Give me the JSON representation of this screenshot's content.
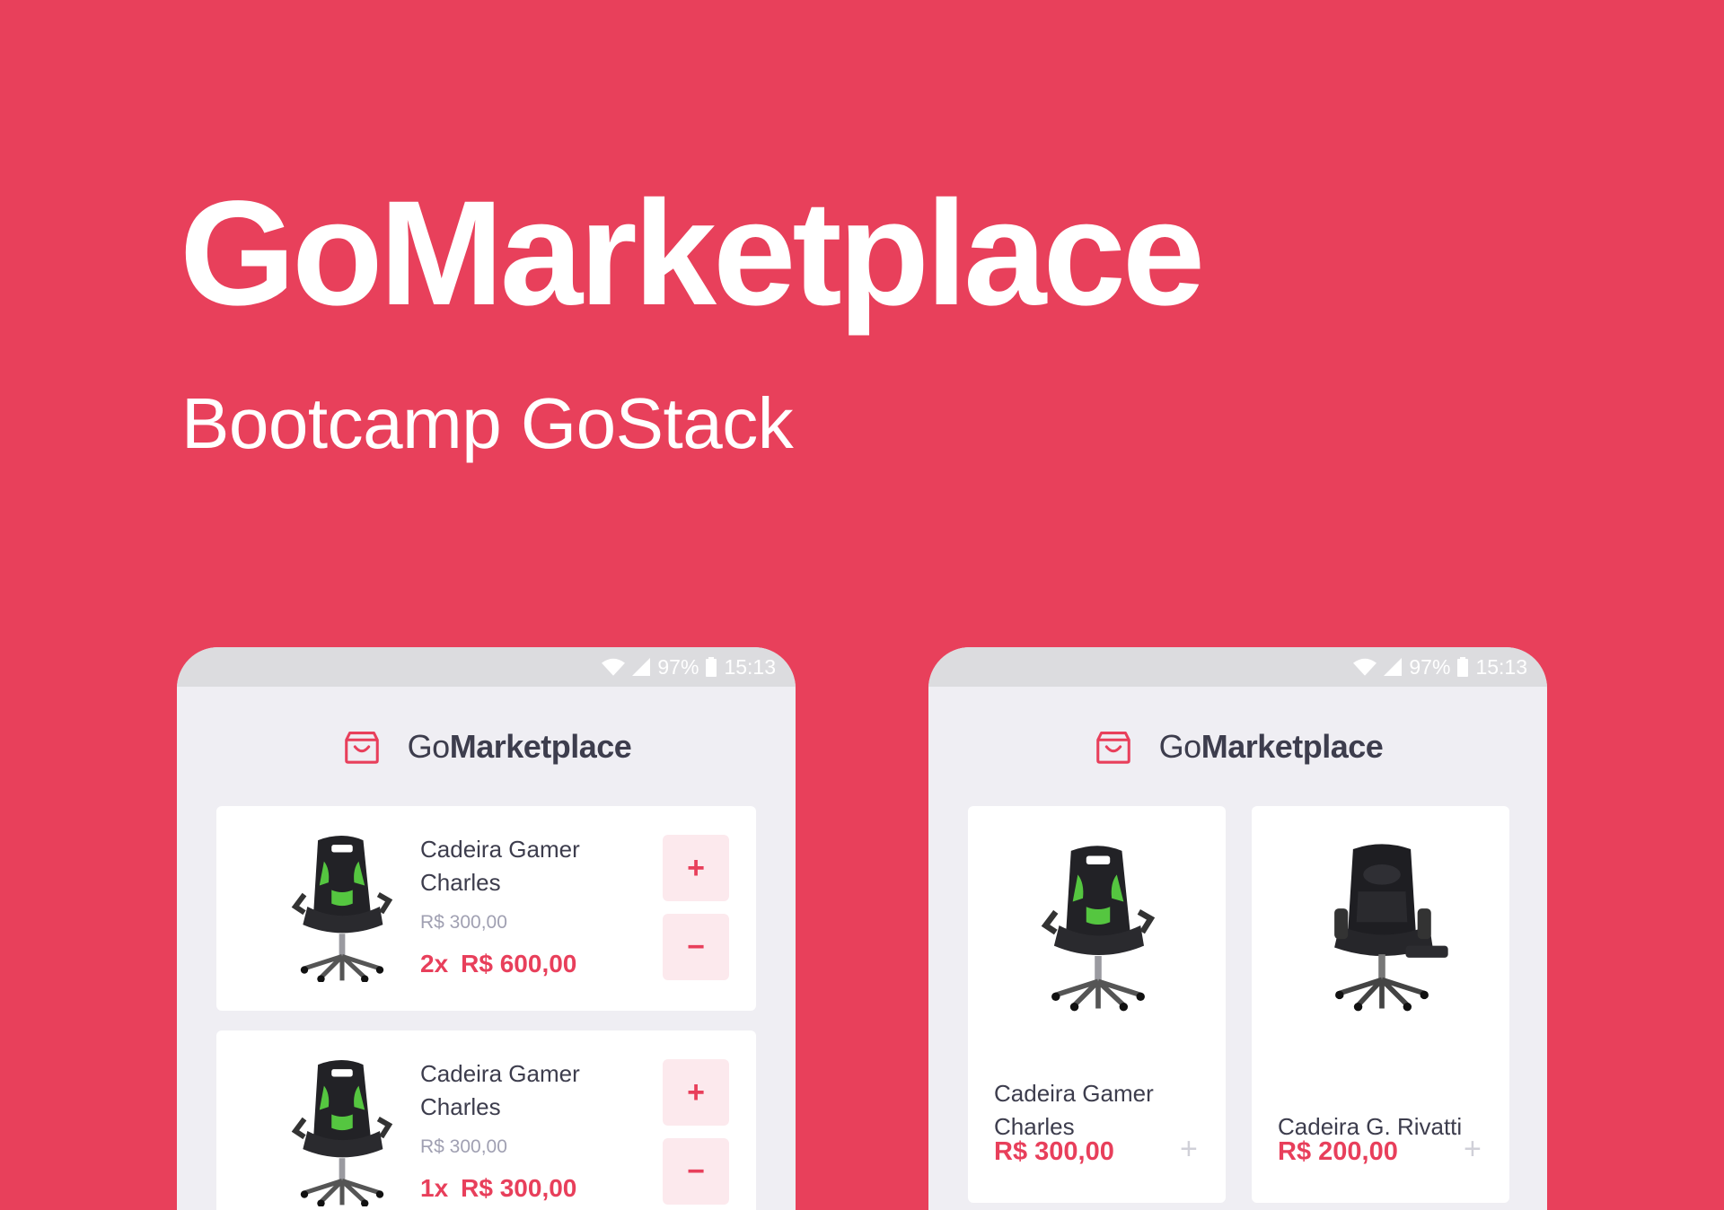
{
  "hero": {
    "title": "GoMarketplace",
    "subtitle": "Bootcamp GoStack"
  },
  "statusbar": {
    "battery": "97%",
    "time": "15:13",
    "icons": [
      "wifi-icon",
      "signal-icon",
      "battery-icon"
    ]
  },
  "app": {
    "brand_prefix": "Go",
    "brand_bold": "Marketplace",
    "cart_icon": "shopping-bag-icon"
  },
  "cart": {
    "items": [
      {
        "name": "Cadeira Gamer Charles",
        "unit_price": "R$ 300,00",
        "quantity": "2x",
        "total": "R$ 600,00",
        "plus": "+",
        "minus": "−"
      },
      {
        "name": "Cadeira Gamer Charles",
        "unit_price": "R$ 300,00",
        "quantity": "1x",
        "total": "R$ 300,00",
        "plus": "+",
        "minus": "−"
      }
    ]
  },
  "catalog": {
    "products": [
      {
        "name": "Cadeira Gamer Charles",
        "price": "R$ 300,00",
        "add": "+"
      },
      {
        "name": "Cadeira G. Rivatti",
        "price": "R$ 200,00",
        "add": "+"
      }
    ]
  },
  "colors": {
    "background": "#E8405B",
    "accent": "#E83F5B",
    "text": "#3D3D4D",
    "muted": "#A0A0B2"
  }
}
